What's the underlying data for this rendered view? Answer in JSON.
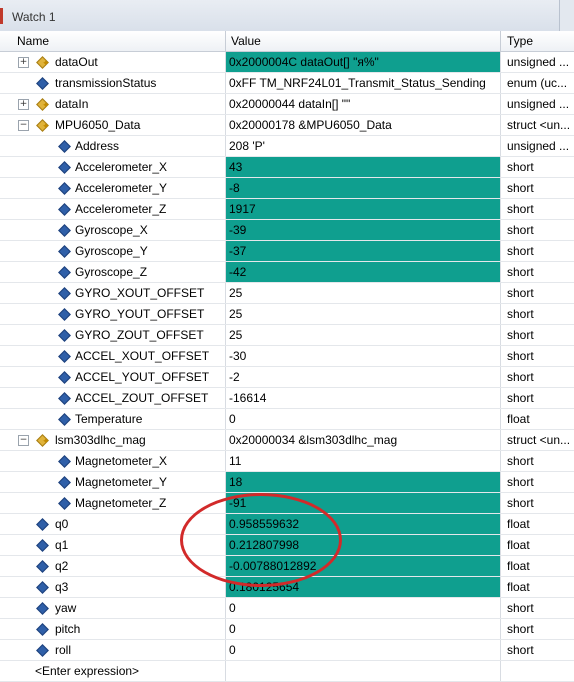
{
  "window": {
    "title": "Watch 1"
  },
  "columns": {
    "name": "Name",
    "value": "Value",
    "type": "Type"
  },
  "rows": [
    {
      "name": "dataOut",
      "value": "0x2000004C dataOut[] \"я%\"",
      "type": "unsigned ...",
      "level": 0,
      "expander": "+",
      "kind": "struct",
      "hl": true
    },
    {
      "name": "transmissionStatus",
      "value": "0xFF TM_NRF24L01_Transmit_Status_Sending",
      "type": "enum (uc...",
      "level": 0,
      "expander": "",
      "kind": "var",
      "hl": false
    },
    {
      "name": "dataIn",
      "value": "0x20000044 dataIn[] \"\"",
      "type": "unsigned ...",
      "level": 0,
      "expander": "+",
      "kind": "struct",
      "hl": false
    },
    {
      "name": "MPU6050_Data",
      "value": "0x20000178 &MPU6050_Data",
      "type": "struct <un...",
      "level": 0,
      "expander": "−",
      "kind": "struct",
      "hl": false
    },
    {
      "name": "Address",
      "value": "208 'P'",
      "type": "unsigned ...",
      "level": 1,
      "expander": "",
      "kind": "var",
      "hl": false
    },
    {
      "name": "Accelerometer_X",
      "value": "43",
      "type": "short",
      "level": 1,
      "expander": "",
      "kind": "var",
      "hl": true
    },
    {
      "name": "Accelerometer_Y",
      "value": "-8",
      "type": "short",
      "level": 1,
      "expander": "",
      "kind": "var",
      "hl": true
    },
    {
      "name": "Accelerometer_Z",
      "value": "1917",
      "type": "short",
      "level": 1,
      "expander": "",
      "kind": "var",
      "hl": true
    },
    {
      "name": "Gyroscope_X",
      "value": "-39",
      "type": "short",
      "level": 1,
      "expander": "",
      "kind": "var",
      "hl": true
    },
    {
      "name": "Gyroscope_Y",
      "value": "-37",
      "type": "short",
      "level": 1,
      "expander": "",
      "kind": "var",
      "hl": true
    },
    {
      "name": "Gyroscope_Z",
      "value": "-42",
      "type": "short",
      "level": 1,
      "expander": "",
      "kind": "var",
      "hl": true
    },
    {
      "name": "GYRO_XOUT_OFFSET",
      "value": "25",
      "type": "short",
      "level": 1,
      "expander": "",
      "kind": "var",
      "hl": false
    },
    {
      "name": "GYRO_YOUT_OFFSET",
      "value": "25",
      "type": "short",
      "level": 1,
      "expander": "",
      "kind": "var",
      "hl": false
    },
    {
      "name": "GYRO_ZOUT_OFFSET",
      "value": "25",
      "type": "short",
      "level": 1,
      "expander": "",
      "kind": "var",
      "hl": false
    },
    {
      "name": "ACCEL_XOUT_OFFSET",
      "value": "-30",
      "type": "short",
      "level": 1,
      "expander": "",
      "kind": "var",
      "hl": false
    },
    {
      "name": "ACCEL_YOUT_OFFSET",
      "value": "-2",
      "type": "short",
      "level": 1,
      "expander": "",
      "kind": "var",
      "hl": false
    },
    {
      "name": "ACCEL_ZOUT_OFFSET",
      "value": "-16614",
      "type": "short",
      "level": 1,
      "expander": "",
      "kind": "var",
      "hl": false
    },
    {
      "name": "Temperature",
      "value": "0",
      "type": "float",
      "level": 1,
      "expander": "",
      "kind": "var",
      "hl": false
    },
    {
      "name": "lsm303dlhc_mag",
      "value": "0x20000034 &lsm303dlhc_mag",
      "type": "struct <un...",
      "level": 0,
      "expander": "−",
      "kind": "struct",
      "hl": false
    },
    {
      "name": "Magnetometer_X",
      "value": "11",
      "type": "short",
      "level": 1,
      "expander": "",
      "kind": "var",
      "hl": false
    },
    {
      "name": "Magnetometer_Y",
      "value": "18",
      "type": "short",
      "level": 1,
      "expander": "",
      "kind": "var",
      "hl": true
    },
    {
      "name": "Magnetometer_Z",
      "value": "-91",
      "type": "short",
      "level": 1,
      "expander": "",
      "kind": "var",
      "hl": true
    },
    {
      "name": "q0",
      "value": "0.958559632",
      "type": "float",
      "level": 0,
      "expander": "",
      "kind": "var",
      "hl": true
    },
    {
      "name": "q1",
      "value": "0.212807998",
      "type": "float",
      "level": 0,
      "expander": "",
      "kind": "var",
      "hl": true
    },
    {
      "name": "q2",
      "value": "-0.00788012892",
      "type": "float",
      "level": 0,
      "expander": "",
      "kind": "var",
      "hl": true
    },
    {
      "name": "q3",
      "value": "0.180125654",
      "type": "float",
      "level": 0,
      "expander": "",
      "kind": "var",
      "hl": true
    },
    {
      "name": "yaw",
      "value": "0",
      "type": "short",
      "level": 0,
      "expander": "",
      "kind": "var",
      "hl": false
    },
    {
      "name": "pitch",
      "value": "0",
      "type": "short",
      "level": 0,
      "expander": "",
      "kind": "var",
      "hl": false
    },
    {
      "name": "roll",
      "value": "0",
      "type": "short",
      "level": 0,
      "expander": "",
      "kind": "var",
      "hl": false
    }
  ],
  "enter_expression": "<Enter expression>",
  "colors": {
    "highlight": "#0f9f8f",
    "annotation": "#d22a2a"
  }
}
